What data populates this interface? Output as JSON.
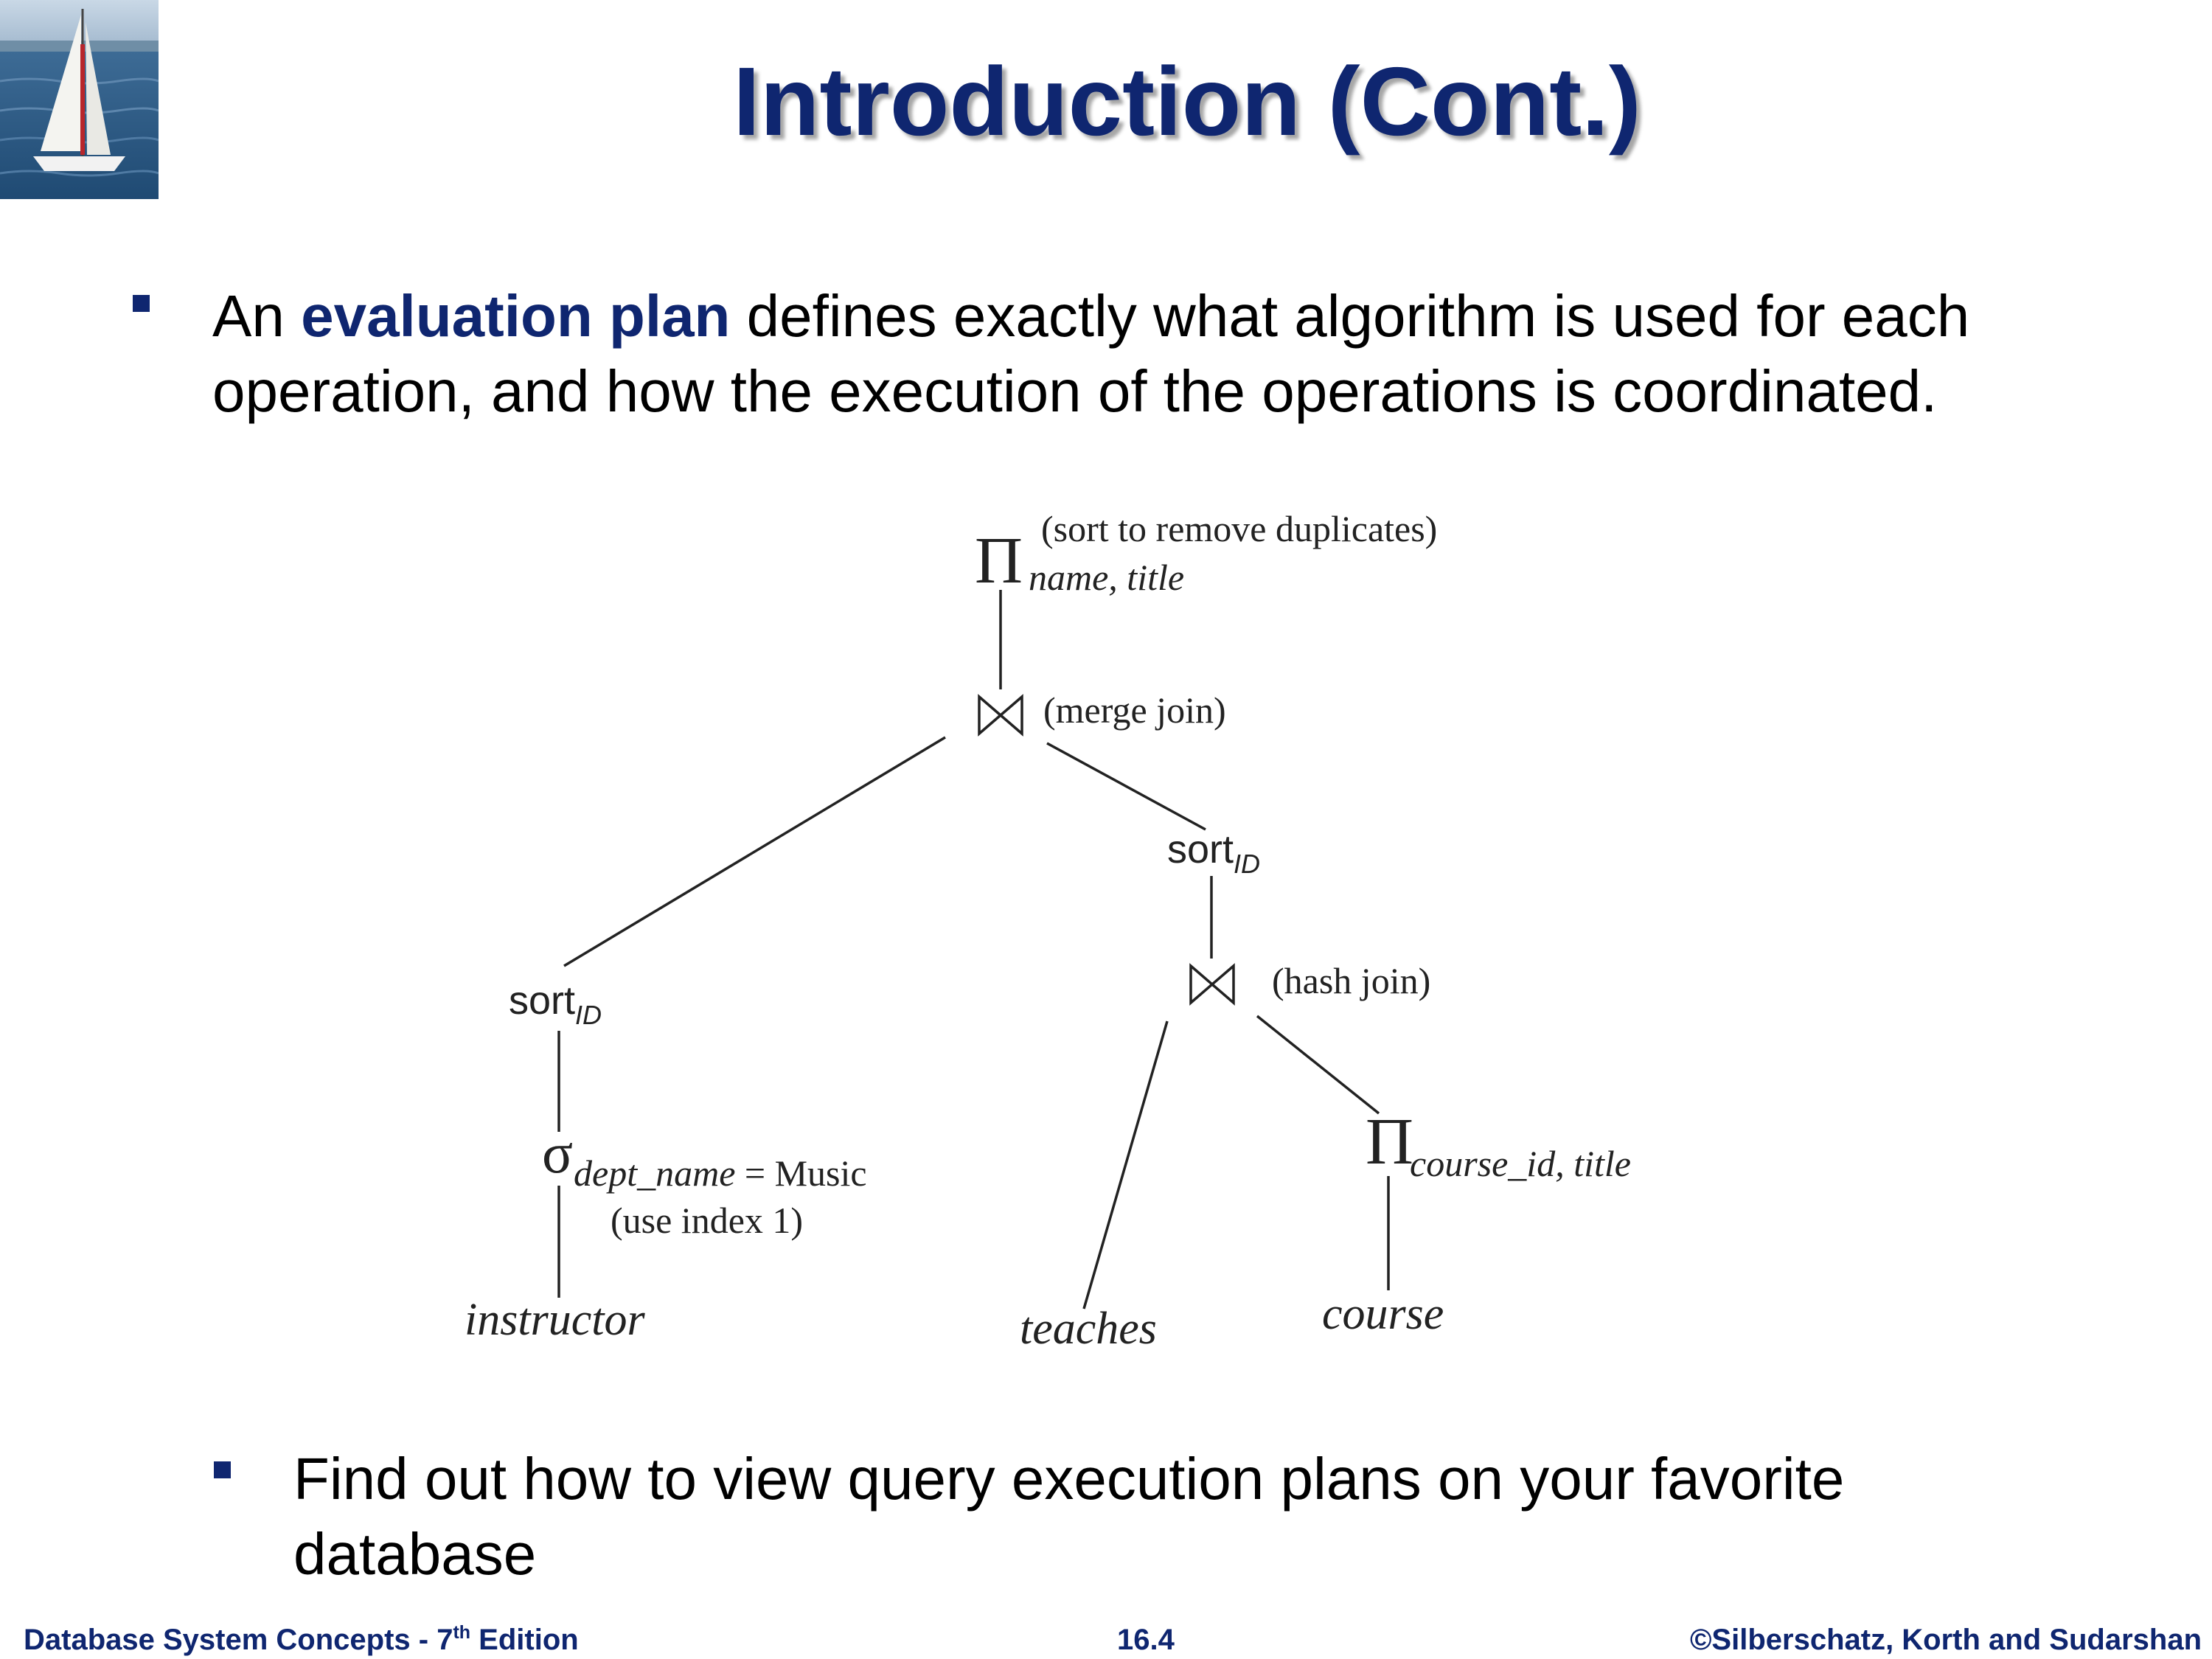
{
  "title": "Introduction (Cont.)",
  "bullet1": {
    "prefix": "An ",
    "emphasis": "evaluation plan",
    "suffix": " defines exactly what algorithm is used for each operation, and how the execution of the operations is coordinated."
  },
  "diagram": {
    "root_symbol": "Π",
    "root_subscript": "name, title",
    "root_note": "(sort to remove duplicates)",
    "join_symbol": "⋈",
    "merge_join_note": "(merge join)",
    "hash_join_note": "(hash join)",
    "sort_text": "sort",
    "sort_subscript": "ID",
    "select_symbol": "σ",
    "select_subscript": "dept_name",
    "select_condition": " = Music",
    "select_note": "(use index 1)",
    "project2_symbol": "Π",
    "project2_subscript": "course_id, title",
    "leaf_instructor": "instructor",
    "leaf_teaches": "teaches",
    "leaf_course": "course"
  },
  "bullet2": "Find out how to view query execution plans on your favorite database",
  "footer": {
    "left_main": "Database System Concepts - 7",
    "left_sup": "th",
    "left_tail": " Edition",
    "center": "16.4",
    "right": "©Silberschatz, Korth and Sudarshan"
  },
  "colors": {
    "accent": "#0f2670",
    "text": "#000000",
    "footer": "#0f2670"
  }
}
